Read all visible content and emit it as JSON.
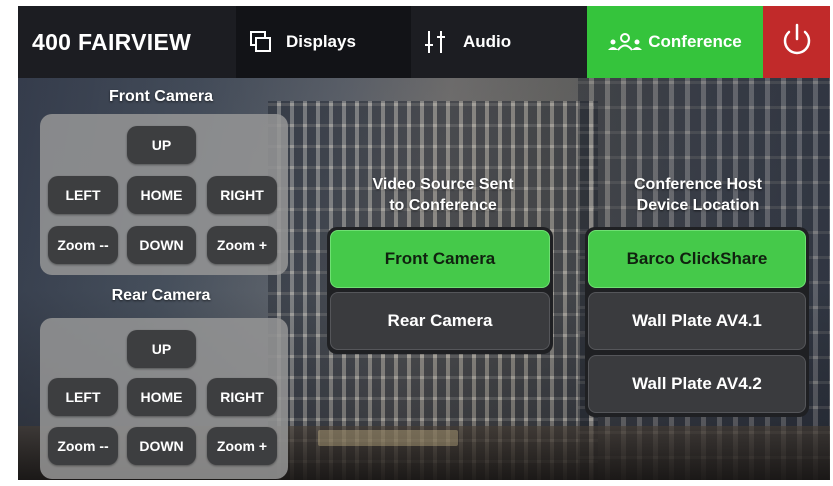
{
  "header": {
    "brand": "400 FAIRVIEW",
    "tabs": [
      {
        "label": "Displays",
        "icon": "displays-icon"
      },
      {
        "label": "Audio",
        "icon": "audio-sliders-icon"
      },
      {
        "label": "Conference",
        "icon": "people-icon",
        "active": true
      }
    ],
    "power_icon": "power-icon"
  },
  "front_camera": {
    "title": "Front Camera",
    "buttons": {
      "up": "UP",
      "left": "LEFT",
      "home": "HOME",
      "right": "RIGHT",
      "zoom_out": "Zoom --",
      "down": "DOWN",
      "zoom_in": "Zoom +"
    }
  },
  "rear_camera": {
    "title": "Rear Camera",
    "buttons": {
      "up": "UP",
      "left": "LEFT",
      "home": "HOME",
      "right": "RIGHT",
      "zoom_out": "Zoom --",
      "down": "DOWN",
      "zoom_in": "Zoom +"
    }
  },
  "video_source": {
    "title_line1": "Video Source Sent",
    "title_line2": "to Conference",
    "options": [
      {
        "label": "Front Camera",
        "selected": true
      },
      {
        "label": "Rear Camera",
        "selected": false
      }
    ]
  },
  "host_location": {
    "title_line1": "Conference Host",
    "title_line2": "Device Location",
    "options": [
      {
        "label": "Barco ClickShare",
        "selected": true
      },
      {
        "label": "Wall Plate  AV4.1",
        "selected": false
      },
      {
        "label": "Wall Plate  AV4.2",
        "selected": false
      }
    ]
  },
  "colors": {
    "header": "#1c1d22",
    "active_tab": "#35c43c",
    "power": "#c12a2a",
    "selected": "#45c94a"
  }
}
